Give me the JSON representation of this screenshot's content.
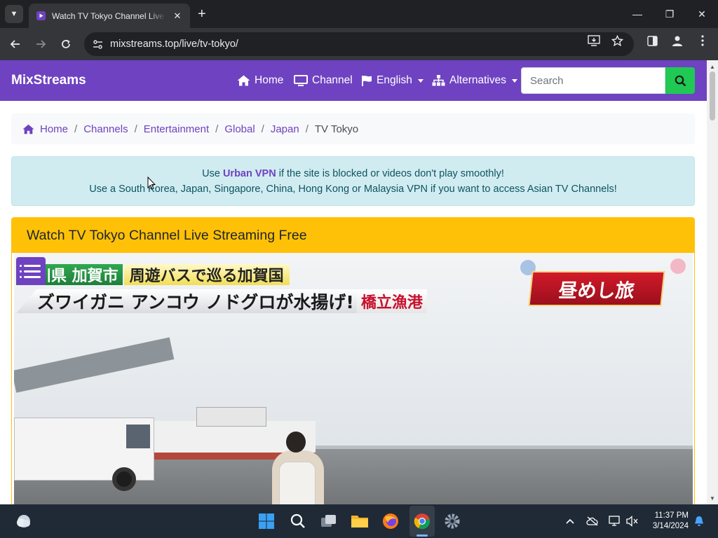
{
  "browser": {
    "tab_title": "Watch TV Tokyo Channel Live Streaming Free",
    "url": "mixstreams.top/live/tv-tokyo/",
    "window_controls": {
      "minimize": "—",
      "restore": "❐",
      "close": "✕"
    }
  },
  "site": {
    "brand": "MixStreams",
    "nav": [
      {
        "label": "Home",
        "icon": "home-icon"
      },
      {
        "label": "Channel",
        "icon": "monitor-icon"
      },
      {
        "label": "English",
        "icon": "flag-icon",
        "dropdown": true
      },
      {
        "label": "Alternatives",
        "icon": "sitemap-icon",
        "dropdown": true
      }
    ],
    "search_placeholder": "Search"
  },
  "breadcrumb": {
    "items": [
      "Home",
      "Channels",
      "Entertainment",
      "Global",
      "Japan"
    ],
    "separator": "/",
    "active": "TV Tokyo"
  },
  "alert": {
    "line1_prefix": "Use ",
    "line1_link": "Urban VPN",
    "line1_suffix": " if the site is blocked or videos don't play smoothly!",
    "line2": "Use a South Korea, Japan, Singapore, China, Hong Kong or Malaysia VPN if you want to access Asian TV Channels!"
  },
  "player_card": {
    "header": "Watch TV Tokyo Channel Live Streaming Free",
    "captions": {
      "location": "石川県 加賀市",
      "subtitle": "周遊バスで巡る加賀国",
      "main": "ズワイガニ アンコウ ノドグロが水揚げ!",
      "port": "橋立漁港",
      "show_logo": "昼めし旅"
    }
  },
  "taskbar": {
    "time": "11:37 PM",
    "date": "3/14/2024"
  },
  "colors": {
    "brand_purple": "#6f42c1",
    "search_green": "#20c954",
    "card_yellow": "#ffc107",
    "alert_bg": "#d1ecf1"
  }
}
